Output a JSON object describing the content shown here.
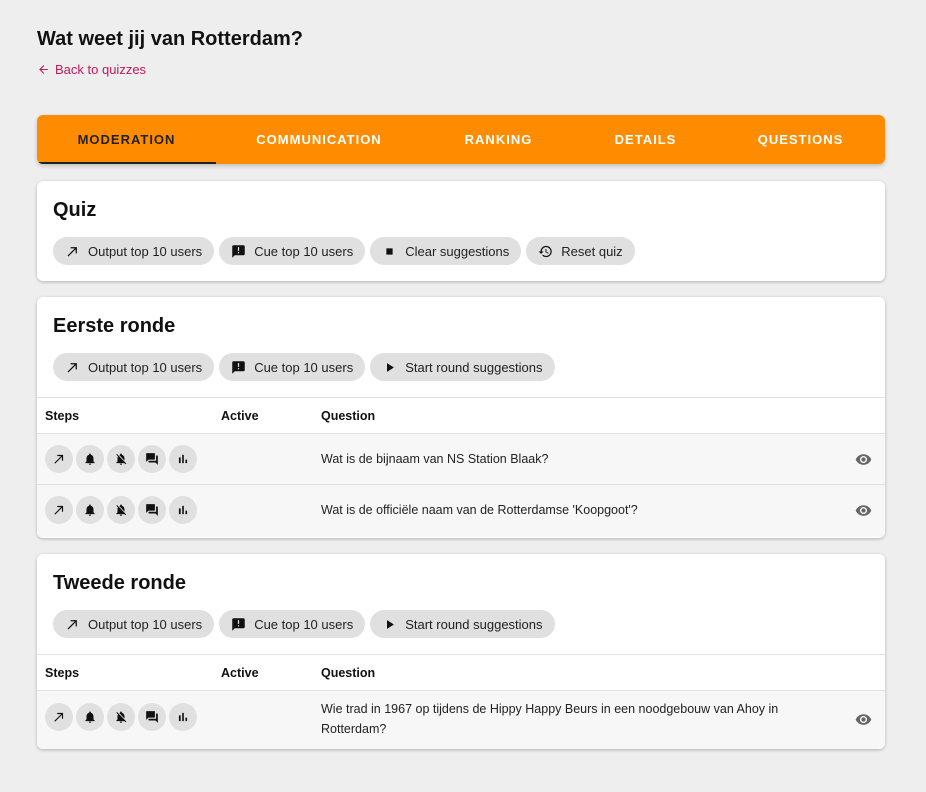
{
  "page": {
    "title": "Wat weet jij van Rotterdam?",
    "back_label": "Back to quizzes",
    "accent_color": "#ff8c00",
    "link_color": "#c2185b"
  },
  "tabs": [
    {
      "label": "MODERATION",
      "active": true
    },
    {
      "label": "COMMUNICATION",
      "active": false
    },
    {
      "label": "RANKING",
      "active": false
    },
    {
      "label": "DETAILS",
      "active": false
    },
    {
      "label": "QUESTIONS",
      "active": false
    }
  ],
  "quiz_card": {
    "title": "Quiz",
    "actions": [
      {
        "label": "Output top 10 users",
        "icon": "arrow-up-right-icon"
      },
      {
        "label": "Cue top 10 users",
        "icon": "announcement-icon"
      },
      {
        "label": "Clear suggestions",
        "icon": "stop-icon"
      },
      {
        "label": "Reset quiz",
        "icon": "history-icon"
      }
    ]
  },
  "table_headers": {
    "steps": "Steps",
    "active": "Active",
    "question": "Question"
  },
  "rounds": [
    {
      "title": "Eerste ronde",
      "actions": [
        {
          "label": "Output top 10 users",
          "icon": "arrow-up-right-icon"
        },
        {
          "label": "Cue top 10 users",
          "icon": "announcement-icon"
        },
        {
          "label": "Start round suggestions",
          "icon": "play-icon"
        }
      ],
      "questions": [
        {
          "text": "Wat is de bijnaam van NS Station Blaak?"
        },
        {
          "text": "Wat is de officiële naam van de Rotterdamse 'Koopgoot'?"
        }
      ]
    },
    {
      "title": "Tweede ronde",
      "actions": [
        {
          "label": "Output top 10 users",
          "icon": "arrow-up-right-icon"
        },
        {
          "label": "Cue top 10 users",
          "icon": "announcement-icon"
        },
        {
          "label": "Start round suggestions",
          "icon": "play-icon"
        }
      ],
      "questions": [
        {
          "text": "Wie trad in 1967 op tijdens de Hippy Happy Beurs in een noodgebouw van Ahoy in Rotterdam?"
        }
      ]
    }
  ],
  "step_icons": [
    "arrow-up-right-icon",
    "bell-icon",
    "bell-off-icon",
    "forum-icon",
    "bar-chart-icon"
  ]
}
